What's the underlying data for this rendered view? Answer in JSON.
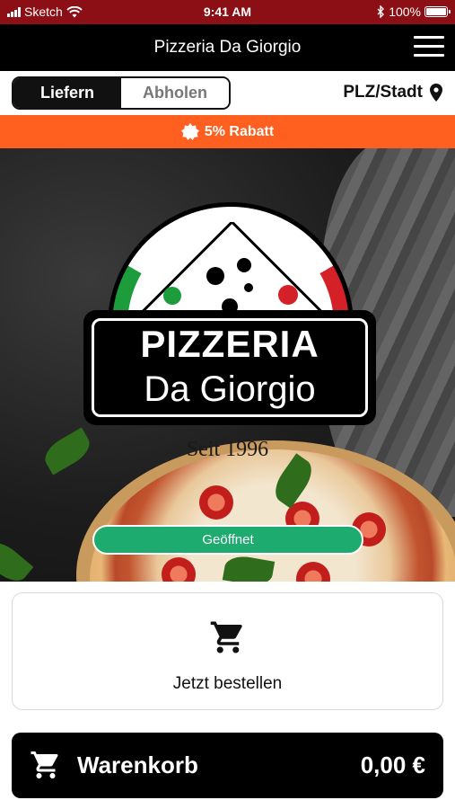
{
  "status_bar": {
    "carrier": "Sketch",
    "time": "9:41 AM",
    "battery": "100%"
  },
  "header": {
    "title": "Pizzeria Da Giorgio"
  },
  "order_mode": {
    "options": [
      "Liefern",
      "Abholen"
    ],
    "selected": "Liefern"
  },
  "location": {
    "label": "PLZ/Stadt"
  },
  "promo": {
    "text": "5% Rabatt"
  },
  "hero": {
    "logo_line1": "PIZZERIA",
    "logo_line2": "Da Giorgio",
    "since": "Seit 1996",
    "status": "Geöffnet"
  },
  "order_card": {
    "label": "Jetzt bestellen"
  },
  "cart": {
    "label": "Warenkorb",
    "total": "0,00 €"
  },
  "colors": {
    "status_bar": "#8b0f14",
    "promo": "#ff5f1f",
    "open_badge": "#1dab6f",
    "header": "#000000"
  },
  "icons": [
    "wifi-icon",
    "bluetooth-icon",
    "battery-icon",
    "menu-icon",
    "location-pin-icon",
    "badge-icon",
    "cart-icon"
  ]
}
